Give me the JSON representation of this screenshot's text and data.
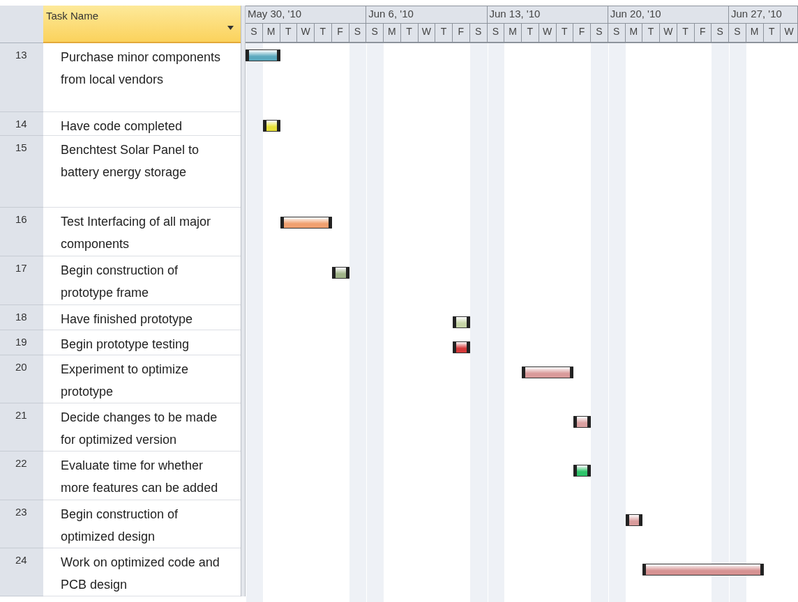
{
  "grid": {
    "task_name_header": "Task Name"
  },
  "timescale": {
    "weeks": [
      {
        "label": "May 30, '10",
        "days": [
          "S",
          "M",
          "T",
          "W",
          "T",
          "F",
          "S"
        ]
      },
      {
        "label": "Jun 6, '10",
        "days": [
          "S",
          "M",
          "T",
          "W",
          "T",
          "F",
          "S"
        ]
      },
      {
        "label": "Jun 13, '10",
        "days": [
          "S",
          "M",
          "T",
          "W",
          "T",
          "F",
          "S"
        ]
      },
      {
        "label": "Jun 20, '10",
        "days": [
          "S",
          "M",
          "T",
          "W",
          "T",
          "F",
          "S"
        ]
      },
      {
        "label": "Jun 27, '10",
        "days": [
          "S",
          "M",
          "T",
          "W"
        ]
      }
    ]
  },
  "tasks": [
    {
      "id": "13",
      "name": "Purchase minor components from local vendors",
      "bar": {
        "color": "#5aa9be"
      }
    },
    {
      "id": "14",
      "name": "Have code completed",
      "bar": {
        "color": "#e6e03a"
      }
    },
    {
      "id": "15",
      "name": "Benchtest Solar Panel to battery energy storage"
    },
    {
      "id": "16",
      "name": "Test Interfacing of all major components",
      "bar": {
        "color": "#f0a070"
      }
    },
    {
      "id": "17",
      "name": "Begin construction of prototype frame",
      "bar": {
        "color": "#9fb388"
      }
    },
    {
      "id": "18",
      "name": "Have finished prototype",
      "bar": {
        "color": "#c6d4a6"
      }
    },
    {
      "id": "19",
      "name": "Begin prototype testing",
      "bar": {
        "color": "#d43a3a"
      }
    },
    {
      "id": "20",
      "name": "Experiment to optimize prototype",
      "bar": {
        "color": "#d99a9a"
      }
    },
    {
      "id": "21",
      "name": "Decide changes to be made for optimized version",
      "bar": {
        "color": "#dba0a0"
      }
    },
    {
      "id": "22",
      "name": "Evaluate time for whether more features can be added",
      "bar": {
        "color": "#2fc46a"
      }
    },
    {
      "id": "23",
      "name": "Begin construction of optimized design",
      "bar": {
        "color": "#d99c9c"
      }
    },
    {
      "id": "24",
      "name": "Work on optimized code and PCB design",
      "bar": {
        "color": "#d69292"
      }
    }
  ]
}
